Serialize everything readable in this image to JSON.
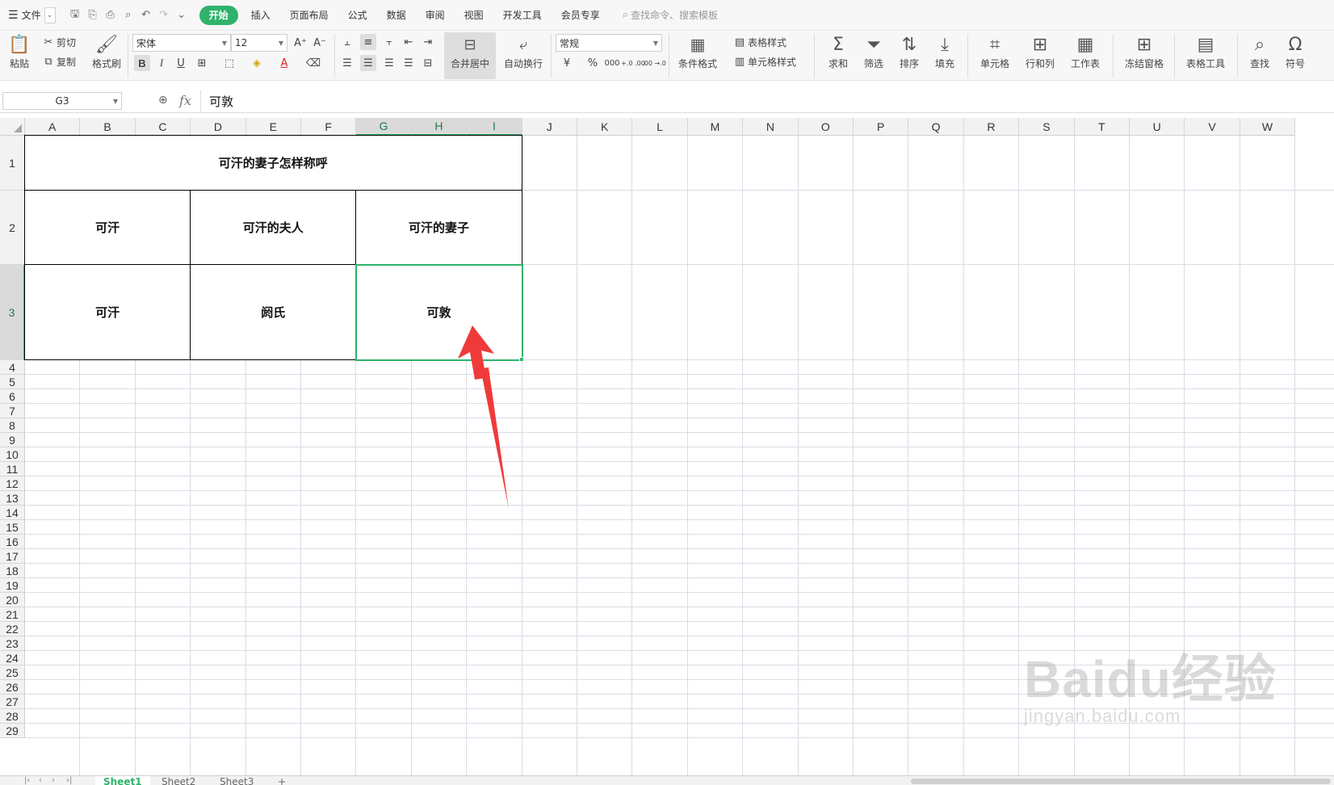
{
  "menubar": {
    "file_label": "文件",
    "tabs": [
      "开始",
      "插入",
      "页面布局",
      "公式",
      "数据",
      "审阅",
      "视图",
      "开发工具",
      "会员专享"
    ],
    "search_placeholder": "查找命令、搜索模板"
  },
  "ribbon": {
    "paste": "粘贴",
    "cut": "剪切",
    "copy": "复制",
    "format_painter": "格式刷",
    "font_name": "宋体",
    "font_size": "12",
    "merge_center": "合并居中",
    "wrap_text": "自动换行",
    "number_format": "常规",
    "conditional_format": "条件格式",
    "table_style": "表格样式",
    "cell_style": "单元格样式",
    "sum": "求和",
    "filter": "筛选",
    "sort": "排序",
    "fill": "填充",
    "cell": "单元格",
    "row_col": "行和列",
    "worksheet": "工作表",
    "freeze": "冻结窗格",
    "table_tools": "表格工具",
    "find": "查找",
    "symbol": "符号",
    "bold": "B",
    "italic": "I",
    "underline": "U",
    "currency": "¥",
    "percent": "%",
    "thousands": "000",
    "dec_increase": "+.0 .00",
    "dec_decrease": ".00 →.0"
  },
  "formula_bar": {
    "name_box": "G3",
    "fx": "fx",
    "value": "可敦"
  },
  "grid": {
    "columns": [
      "A",
      "B",
      "C",
      "D",
      "E",
      "F",
      "G",
      "H",
      "I",
      "J",
      "K",
      "L",
      "M",
      "N",
      "O",
      "P",
      "Q",
      "R",
      "S",
      "T",
      "U",
      "V",
      "W"
    ],
    "rows": [
      "1",
      "2",
      "3",
      "4",
      "5",
      "6",
      "7",
      "8",
      "9",
      "10",
      "11",
      "12",
      "13",
      "14",
      "15",
      "16",
      "17",
      "18",
      "19",
      "20",
      "21",
      "22",
      "23",
      "24",
      "25",
      "26",
      "27",
      "28",
      "29"
    ],
    "selected_column_group": [
      "G",
      "H",
      "I"
    ],
    "selected_row": "3",
    "cells": {
      "title": "可汗的妻子怎样称呼",
      "r2c1": "可汗",
      "r2c2": "可汗的夫人",
      "r2c3": "可汗的妻子",
      "r3c1": "可汗",
      "r3c2": "阏氏",
      "r3c3": "可敦"
    }
  },
  "sheets": [
    "Sheet1",
    "Sheet2",
    "Sheet3"
  ],
  "add_sheet": "+",
  "watermark": {
    "main": "Baidu经验",
    "sub": "jingyan.baidu.com"
  },
  "accent_color": "#2fb36b",
  "arrow_color": "#f03a3a"
}
